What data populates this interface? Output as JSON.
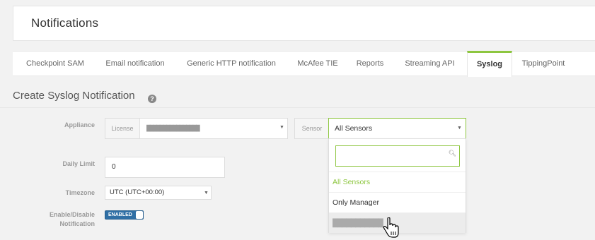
{
  "header": {
    "title": "Notifications"
  },
  "tabs": [
    {
      "label": "Checkpoint SAM"
    },
    {
      "label": "Email notification"
    },
    {
      "label": "Generic HTTP notification"
    },
    {
      "label": "McAfee TIE"
    },
    {
      "label": "Reports"
    },
    {
      "label": "Streaming API"
    },
    {
      "label": "Syslog",
      "active": true
    },
    {
      "label": "TippingPoint"
    }
  ],
  "section": {
    "title": "Create Syslog Notification"
  },
  "form": {
    "appliance_label": "Appliance",
    "license_addon": "License",
    "license_value": "████████████████",
    "sensor_addon": "Sensor",
    "sensor_value": "All Sensors",
    "daily_limit_label": "Daily Limit",
    "daily_limit_value": "0",
    "timezone_label": "Timezone",
    "timezone_value": "UTC (UTC+00:00)",
    "enable_label_line1": "Enable/Disable",
    "enable_label_line2": "Notification",
    "toggle_label": "ENABLED"
  },
  "sensor_dropdown": {
    "search_value": "",
    "options": [
      {
        "label": "All Sensors",
        "selected": true
      },
      {
        "label": "Only Manager"
      },
      {
        "label": "███████████"
      }
    ]
  },
  "colors": {
    "accent": "#8dc63f",
    "toggle": "#2f6fa5"
  }
}
